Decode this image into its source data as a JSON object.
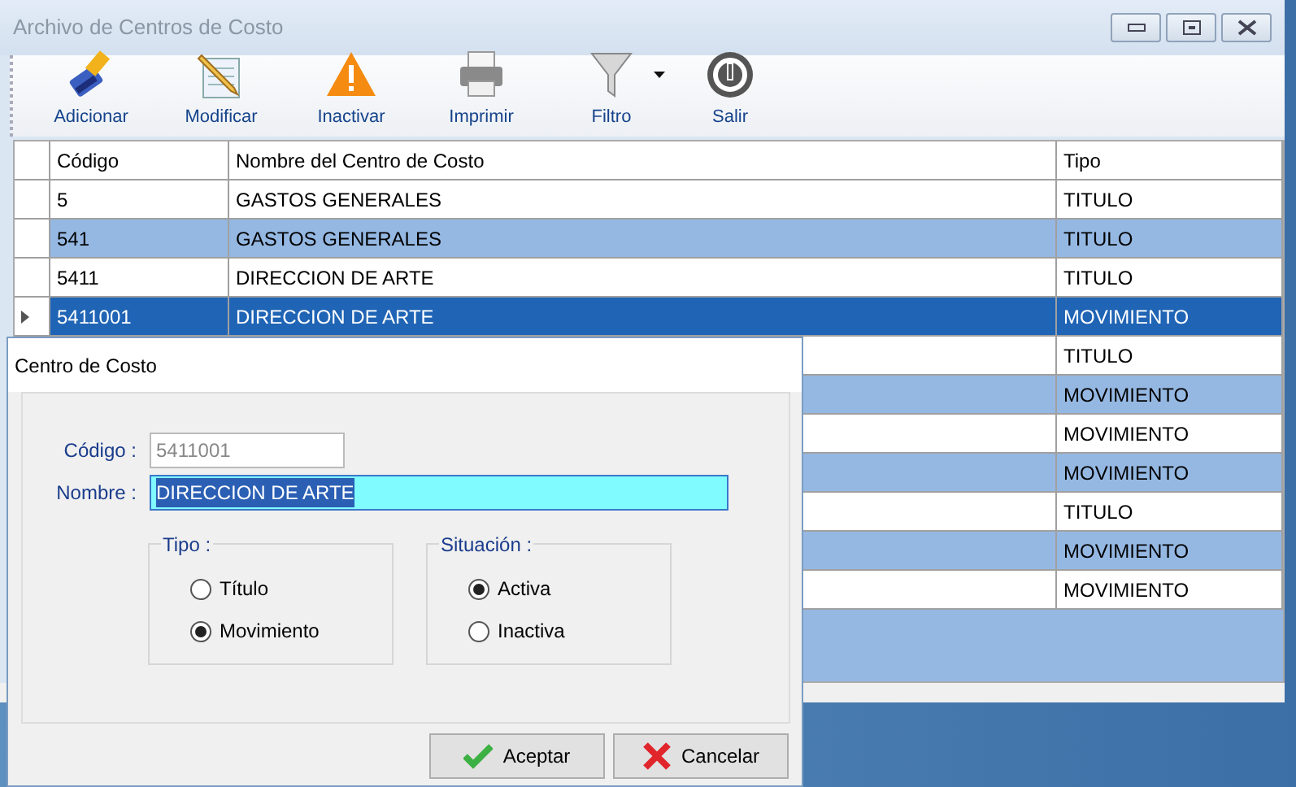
{
  "window": {
    "title": "Archivo de Centros de Costo"
  },
  "toolbar": [
    {
      "label": "Adicionar",
      "kind": "add",
      "has_menu": false
    },
    {
      "label": "Modificar",
      "kind": "edit",
      "has_menu": false
    },
    {
      "label": "Inactivar",
      "kind": "warning",
      "has_menu": false
    },
    {
      "label": "Imprimir",
      "kind": "print",
      "has_menu": false
    },
    {
      "label": "Filtro",
      "kind": "filter",
      "has_menu": true
    },
    {
      "label": "Salir",
      "kind": "exit",
      "has_menu": false
    }
  ],
  "table": {
    "columns": [
      "Código",
      "Nombre del Centro de Costo",
      "Tipo"
    ],
    "rows": [
      {
        "codigo": "5",
        "nombre": "GASTOS GENERALES",
        "tipo": "TITULO",
        "selected": false
      },
      {
        "codigo": "541",
        "nombre": "GASTOS GENERALES",
        "tipo": "TITULO",
        "selected": false
      },
      {
        "codigo": "5411",
        "nombre": "DIRECCION DE ARTE",
        "tipo": "TITULO",
        "selected": false
      },
      {
        "codigo": "5411001",
        "nombre": "DIRECCION DE ARTE",
        "tipo": "MOVIMIENTO",
        "selected": true
      },
      {
        "tipo": "TITULO",
        "selected": false
      },
      {
        "tipo": "MOVIMIENTO",
        "selected": false
      },
      {
        "tipo": "MOVIMIENTO",
        "selected": false
      },
      {
        "tipo": "MOVIMIENTO",
        "selected": false
      },
      {
        "tipo": "TITULO",
        "selected": false
      },
      {
        "tipo": "MOVIMIENTO",
        "selected": false
      },
      {
        "tipo": "MOVIMIENTO",
        "selected": false
      }
    ]
  },
  "dialog": {
    "title": "Centro de Costo",
    "fields": [
      {
        "label": "Código :",
        "value": "5411001",
        "readonly": true,
        "focused": false
      },
      {
        "label": "Nombre :",
        "value": "DIRECCION DE ARTE",
        "readonly": false,
        "focused": true
      }
    ],
    "groups": [
      {
        "title": "Tipo :",
        "options": [
          {
            "label": "Título",
            "selected": false
          },
          {
            "label": "Movimiento",
            "selected": true
          }
        ]
      },
      {
        "title": "Situación :",
        "options": [
          {
            "label": "Activa",
            "selected": true
          },
          {
            "label": "Inactiva",
            "selected": false
          }
        ]
      }
    ],
    "buttons": [
      {
        "label": "Aceptar",
        "kind": "ok"
      },
      {
        "label": "Cancelar",
        "kind": "cancel"
      }
    ]
  }
}
